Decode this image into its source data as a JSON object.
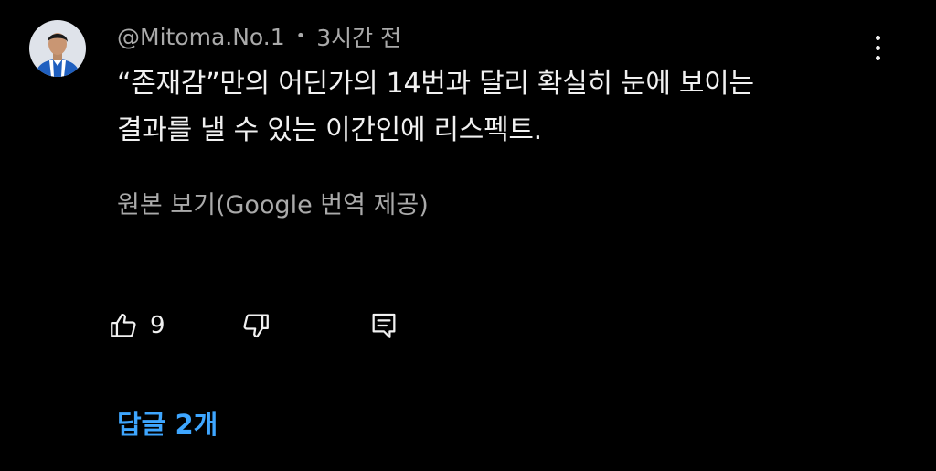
{
  "comment": {
    "author": "@Mitoma.No.1",
    "separator": "•",
    "time_ago": "3시간 전",
    "text": "“존재감”만의 어딘가의 14번과 달리 확실히 눈에 보이는\n결과를 낼 수 있는 이간인에 리스펙트.",
    "translate_label": "원본 보기(Google 번역 제공)",
    "like_count": "9",
    "replies_label": "답글 2개"
  },
  "icons": {
    "avatar": "user-avatar",
    "more": "more-vert-icon",
    "like": "thumb-up-icon",
    "dislike": "thumb-down-icon",
    "reply": "reply-comment-icon"
  },
  "colors": {
    "background": "#000000",
    "text_primary": "#f1f1f1",
    "text_secondary": "#aaaaaa",
    "link_blue": "#3ea6ff",
    "avatar_bg": "#dfe3ea",
    "jersey_blue": "#1f5fbf"
  }
}
